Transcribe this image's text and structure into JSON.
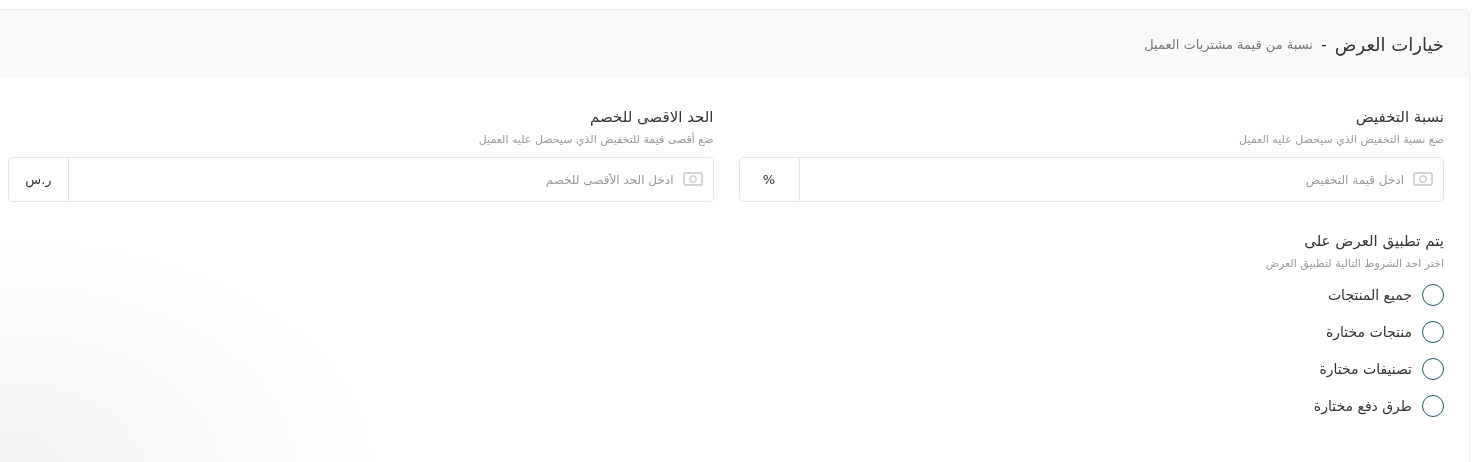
{
  "header": {
    "title": "خيارات العرض",
    "separator": "-",
    "subtitle": "نسبة من قيمة مشتريات العميل"
  },
  "fields": [
    {
      "label": "نسبة التخفيض",
      "hint": "ضع نسبة التخفيض الذي سيحصل عليه العميل",
      "placeholder": "ادخل قيمة التخفيض",
      "unit": "%"
    },
    {
      "label": "الحد الاقصى للخصم",
      "hint": "ضع أقصى قيمة للتخفيض الذي سيحصل عليه العميل",
      "placeholder": "ادخل الحد الأقصى للخصم",
      "unit": "ر.س"
    }
  ],
  "apply": {
    "label": "يتم تطبيق العرض على",
    "hint": "اختر احد الشروط التالية لتطبيق العرض",
    "options": [
      {
        "label": "جميع المنتجات",
        "selected": false
      },
      {
        "label": "منتجات مختارة",
        "selected": false
      },
      {
        "label": "تصنيفات مختارة",
        "selected": false
      },
      {
        "label": "طرق دفع مختارة",
        "selected": false
      }
    ]
  }
}
